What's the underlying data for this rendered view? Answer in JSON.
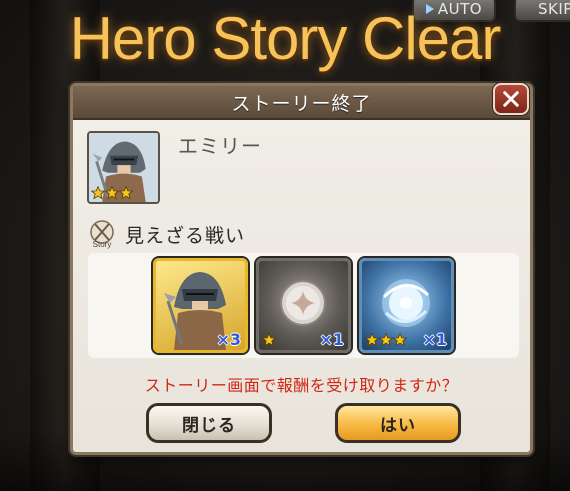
{
  "header": {
    "title": "Hero Story Clear",
    "auto_label": "AUTO",
    "skip_label": "SKIP"
  },
  "dialog": {
    "title": "ストーリー終了",
    "character": {
      "name": "エミリー",
      "rarity": 3
    },
    "story": {
      "icon_label": "Story",
      "title": "見えざる戦い"
    },
    "rewards": [
      {
        "name": "character-piece",
        "count": "×3",
        "stars": 0
      },
      {
        "name": "silver-orb",
        "count": "×1",
        "stars": 1
      },
      {
        "name": "blue-orb",
        "count": "×1",
        "stars": 3
      }
    ],
    "prompt": "ストーリー画面で報酬を受け取りますか？",
    "close_label": "閉じる",
    "yes_label": "はい"
  },
  "colors": {
    "title_gold": "#f6c35a",
    "prompt_red": "#d32515",
    "count_blue": "#2d5bd8",
    "yes_orange": "#f7b944"
  }
}
